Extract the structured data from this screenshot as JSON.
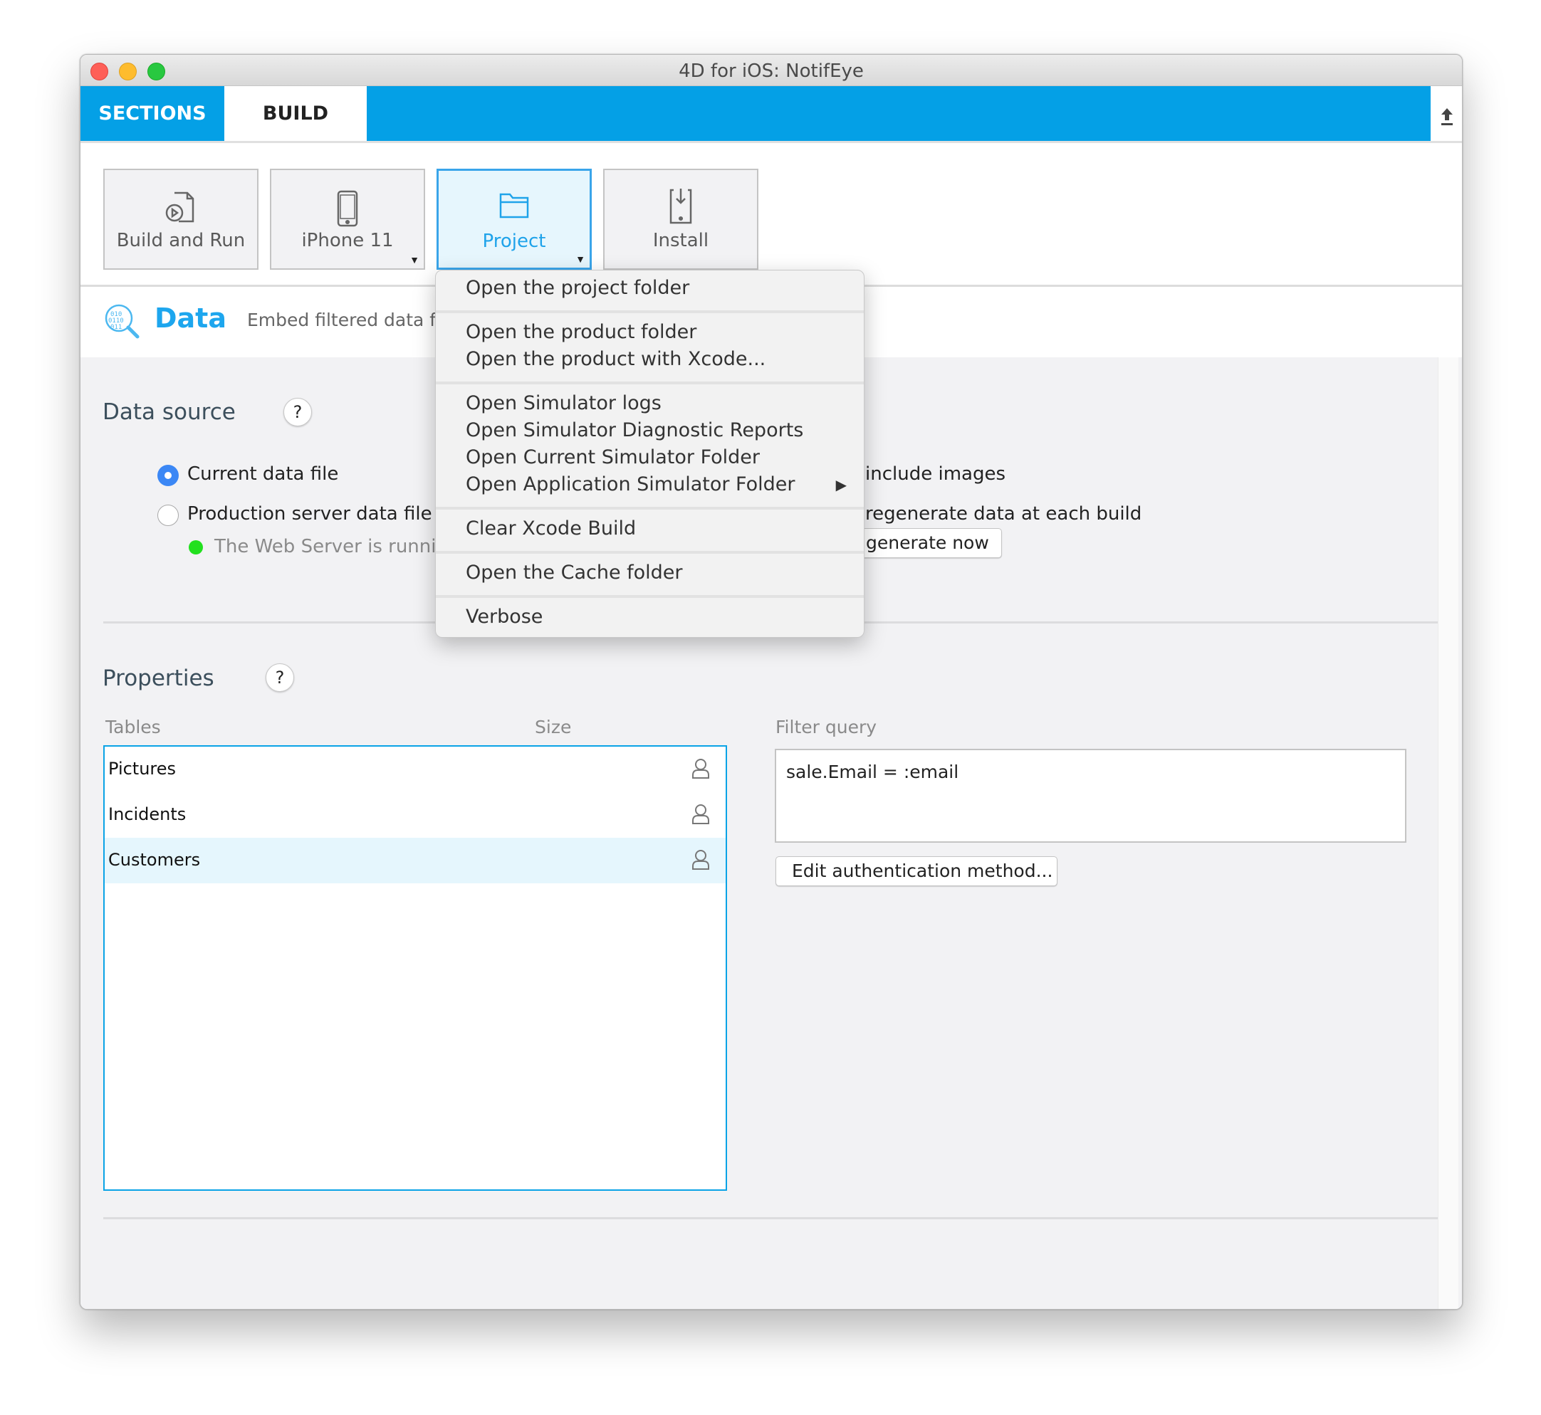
{
  "window": {
    "title": "4D for iOS: NotifEye",
    "traffic_lights": {
      "close": "#fe5f57",
      "minimize": "#febc2e",
      "zoom": "#28c840"
    }
  },
  "tabs": [
    {
      "label": "SECTIONS",
      "active": false
    },
    {
      "label": "BUILD",
      "active": true
    }
  ],
  "tabbar": {
    "accent": "#04a0e6",
    "upload_icon": "upload-icon"
  },
  "toolbar": {
    "buttons": [
      {
        "label": "Build and Run",
        "icon": "build-run-icon",
        "dropdown": false,
        "active": false
      },
      {
        "label": "iPhone 11",
        "icon": "iphone-icon",
        "dropdown": true,
        "active": false
      },
      {
        "label": "Project",
        "icon": "folder-icon",
        "dropdown": true,
        "active": true
      },
      {
        "label": "Install",
        "icon": "install-icon",
        "dropdown": false,
        "active": false
      }
    ]
  },
  "section_header": {
    "icon": "data-search-icon",
    "title": "Data",
    "description": "Embed filtered data fo"
  },
  "data_source": {
    "title": "Data source",
    "help": "?",
    "options": [
      {
        "label": "Current data file",
        "selected": true
      },
      {
        "label": "Production server data file",
        "selected": false
      }
    ],
    "server_status": {
      "text": "The Web Server is running",
      "color": "#22e01e"
    },
    "include_images_label": "include images",
    "regenerate_label": "regenerate data at each build",
    "regenerate_now_label": "generate now"
  },
  "properties": {
    "title": "Properties",
    "help": "?",
    "columns": {
      "tables": "Tables",
      "size": "Size"
    },
    "tables": [
      {
        "name": "Pictures",
        "icon": "user-icon",
        "selected": false
      },
      {
        "name": "Incidents",
        "icon": "user-icon",
        "selected": false
      },
      {
        "name": "Customers",
        "icon": "user-icon",
        "selected": true
      }
    ],
    "filter_label": "Filter query",
    "filter_value": "sale.Email = :email",
    "edit_auth_label": "Edit authentication method..."
  },
  "project_menu": {
    "groups": [
      [
        "Open the project folder"
      ],
      [
        "Open the product folder",
        "Open the product with Xcode..."
      ],
      [
        "Open Simulator logs",
        "Open Simulator Diagnostic Reports",
        "Open Current Simulator Folder",
        "Open Application Simulator Folder"
      ],
      [
        "Clear Xcode Build"
      ],
      [
        "Open the Cache folder"
      ],
      [
        "Verbose"
      ]
    ],
    "submenu_item": "Open Application Simulator Folder"
  }
}
